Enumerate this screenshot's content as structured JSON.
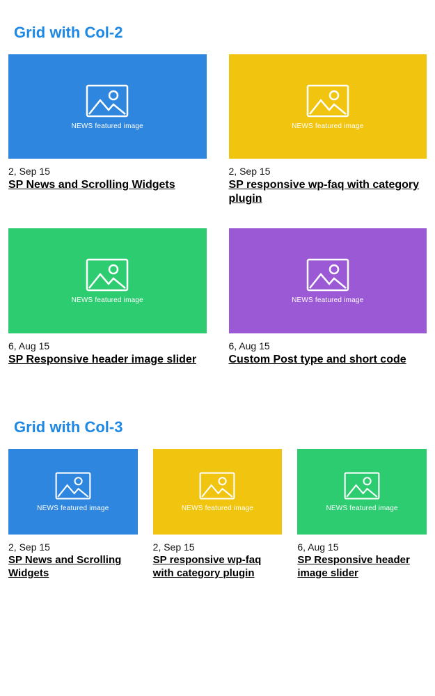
{
  "thumb_label": "NEWS featured image",
  "sections": [
    {
      "heading": "Grid with Col-2",
      "cards": [
        {
          "date": "2, Sep 15",
          "title": "SP News and Scrolling Widgets",
          "color": "blue"
        },
        {
          "date": "2, Sep 15",
          "title": "SP responsive wp-faq with cate­gory plugin",
          "color": "yellow"
        },
        {
          "date": "6, Aug 15",
          "title": "SP Responsive header image slider",
          "color": "green"
        },
        {
          "date": "6, Aug 15",
          "title": "Custom Post type and short code",
          "color": "purple"
        }
      ]
    },
    {
      "heading": "Grid with Col-3",
      "cards": [
        {
          "date": "2, Sep 15",
          "title": "SP News and Scrolling Widgets",
          "color": "blue"
        },
        {
          "date": "2, Sep 15",
          "title": "SP responsive wp-faq with cate­gory plugin",
          "color": "yellow"
        },
        {
          "date": "6, Aug 15",
          "title": "SP Responsive header image slider",
          "color": "green"
        }
      ]
    }
  ]
}
